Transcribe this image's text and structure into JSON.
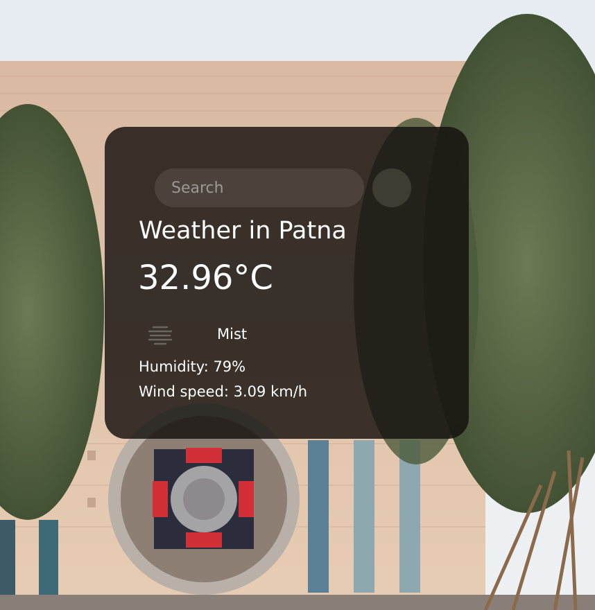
{
  "search": {
    "placeholder": "Search",
    "button_icon": "search-icon"
  },
  "weather": {
    "title": "Weather in Patna",
    "temperature": "32.96°C",
    "condition": "Mist",
    "condition_icon": "mist-icon",
    "humidity": "Humidity: 79%",
    "wind": "Wind speed: 3.09 km/h"
  },
  "colors": {
    "card_background": "#14100e",
    "text": "#ffffff"
  }
}
